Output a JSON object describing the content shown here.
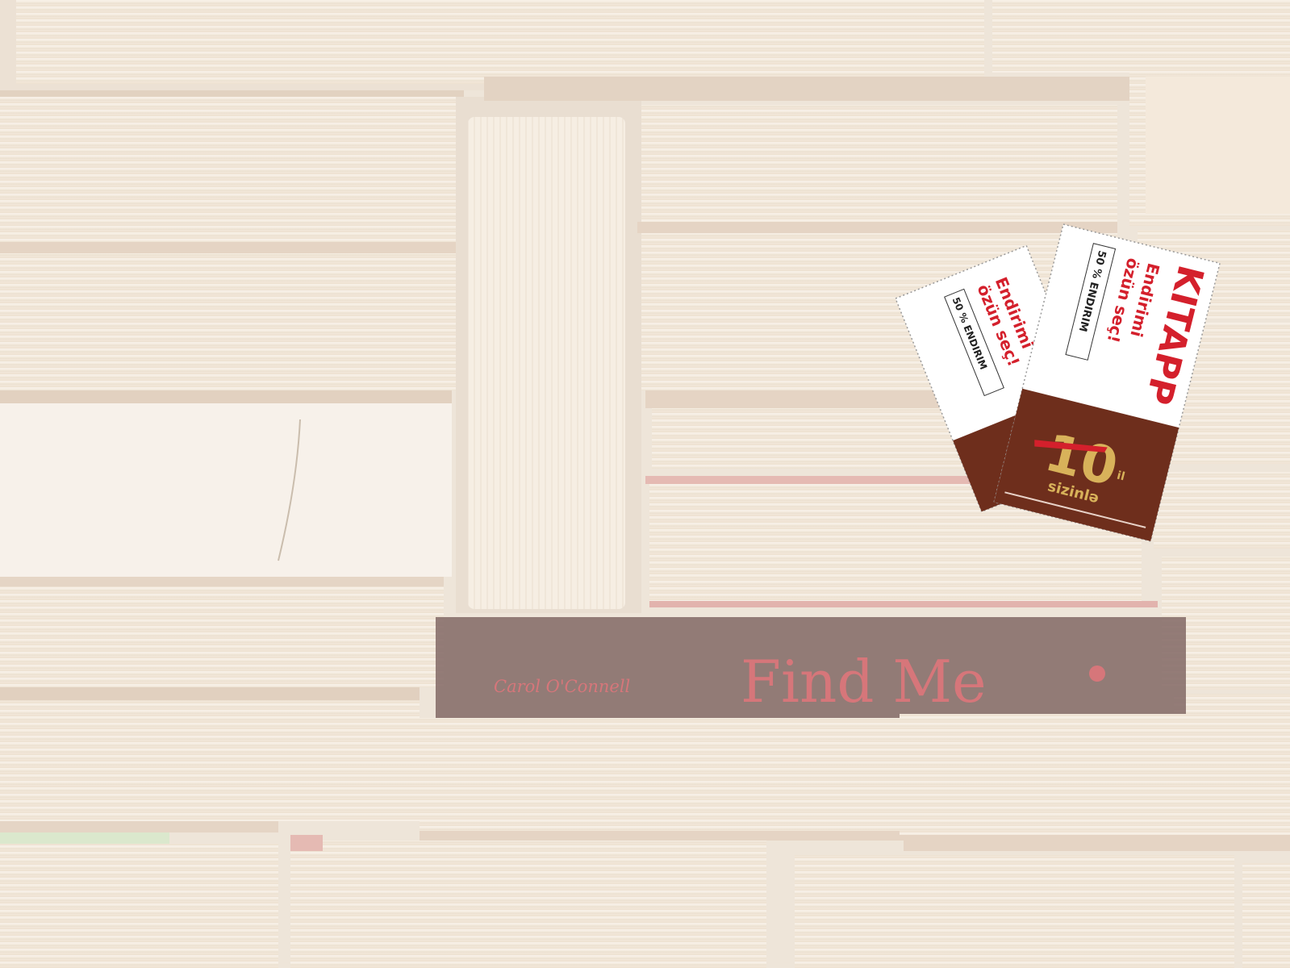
{
  "spine": {
    "author": "Carol O'Connell",
    "title": "Find Me"
  },
  "coupon_back": {
    "line1": "Endirimi",
    "line2": "özün seç!",
    "badge": "50 % ENDIRIM"
  },
  "coupon_front": {
    "brand": "KITAPP",
    "line1": "Endirimi",
    "line2": "özün seç!",
    "badge": "50 % ENDIRIM",
    "anniversary_number": "10",
    "anniversary_unit": "il",
    "anniversary_word": "sizinlə"
  },
  "colors": {
    "brand_red": "#d4202c",
    "chocolate": "#6e2e1c",
    "gold": "#d8b25a",
    "spine_dark": "#5a2f2a",
    "spine_text": "#c8484e"
  }
}
